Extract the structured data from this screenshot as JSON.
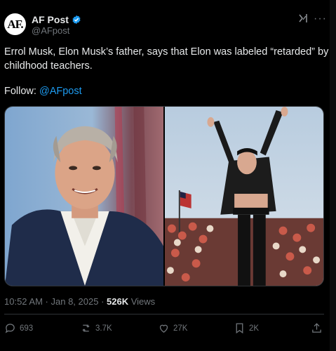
{
  "author": {
    "avatar_text": "AF.",
    "name": "AF Post",
    "handle": "@AFpost"
  },
  "post": {
    "text": "Errol Musk, Elon Musk’s father, says that Elon was labeled “retarded” by childhood teachers.",
    "follow_label": "Follow: ",
    "follow_mention": "@AFpost"
  },
  "meta": {
    "time": "10:52 AM",
    "dot1": " · ",
    "date": "Jan 8, 2025",
    "dot2": " · ",
    "views_count": "526K",
    "views_label": " Views"
  },
  "actions": {
    "replies": "693",
    "reposts": "3.7K",
    "likes": "27K",
    "bookmarks": "2K"
  },
  "colors": {
    "background": "#000000",
    "text": "#e7e9ea",
    "muted": "#71767b",
    "accent": "#1d9bf0"
  }
}
